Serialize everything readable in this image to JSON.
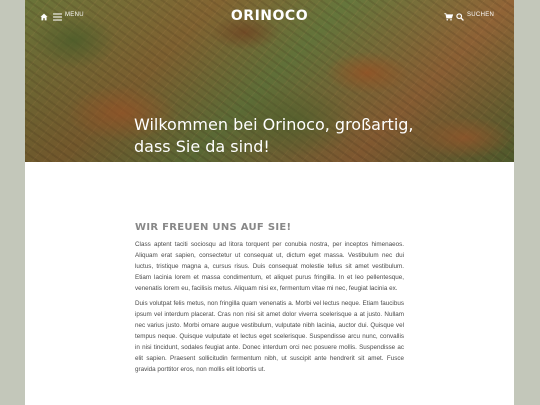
{
  "header": {
    "menu_label": "MENU",
    "logo_text": "ORINOCO",
    "search_label": "SUCHEN"
  },
  "hero": {
    "headline_line1": "Wilkommen bei Orinoco, großartig,",
    "headline_line2": "dass Sie da sind!"
  },
  "main": {
    "section_title": "WIR FREUEN UNS AUF SIE!",
    "paragraph1": "Class aptent taciti sociosqu ad litora torquent per conubia nostra, per inceptos himenaeos. Aliquam erat sapien, consectetur ut consequat ut, dictum eget massa. Vestibulum nec dui luctus, tristique magna a, cursus risus. Duis consequat molestie tellus sit amet vestibulum. Etiam lacinia lorem et massa condimentum, et aliquet purus fringilla. In et leo pellentesque, venenatis lorem eu, facilisis metus. Aliquam nisi ex, fermentum vitae mi nec, feugiat lacinia ex.",
    "paragraph2": "Duis volutpat felis metus, non fringilla quam venenatis a. Morbi vel lectus neque. Etiam faucibus ipsum vel interdum placerat. Cras non nisi sit amet dolor viverra scelerisque a at justo. Nullam nec varius justo. Morbi ornare augue vestibulum, vulputate nibh lacinia, auctor dui. Quisque vel tempus neque. Quisque vulputate et lectus eget scelerisque. Suspendisse arcu nunc, convallis in nisi tincidunt, sodales feugiat ante. Donec interdum orci nec posuere mollis. Suspendisse ac elit sapien. Praesent sollicitudin fermentum nibh, ut suscipit ante hendrerit sit amet. Fusce gravida porttitor eros, non mollis elit lobortis ut."
  },
  "icons": {
    "home": "home-icon",
    "menu": "hamburger-menu-icon",
    "cart": "cart-icon",
    "search": "search-icon"
  },
  "colors": {
    "page_background": "#c3c7ba",
    "content_background": "#ffffff",
    "header_text": "#ffffff",
    "body_text": "#4a4a4a",
    "section_title": "#888888"
  }
}
